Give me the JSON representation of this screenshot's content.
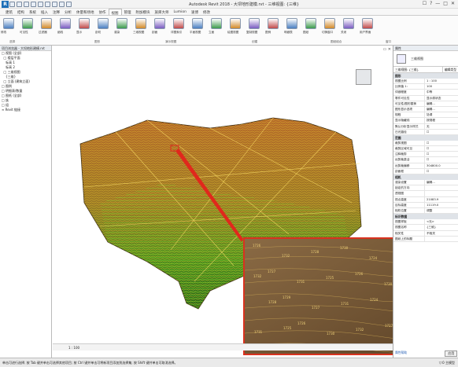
{
  "window": {
    "title": "Autodesk Revit 2018 - 大坝地形建模.rvt - 三维视图: {三维}",
    "right_controls": [
      "☐",
      "?",
      "—",
      "□",
      "✕"
    ]
  },
  "tabs": [
    {
      "label": "建筑"
    },
    {
      "label": "结构"
    },
    {
      "label": "系统"
    },
    {
      "label": "插入"
    },
    {
      "label": "注释"
    },
    {
      "label": "分析"
    },
    {
      "label": "体量和场地"
    },
    {
      "label": "协作"
    },
    {
      "label": "视图",
      "active": true
    },
    {
      "label": "管理"
    },
    {
      "label": "附加模块"
    },
    {
      "label": "族库大师"
    },
    {
      "label": "Lumion"
    },
    {
      "label": "速博"
    },
    {
      "label": "修改"
    }
  ],
  "ribbon": {
    "buttons": [
      {
        "label": "修改",
        "icon": "arrow-icon"
      },
      {
        "label": "可见性",
        "icon": "eye-icon"
      },
      {
        "label": "过滤器",
        "icon": "filter-icon"
      },
      {
        "label": "细线",
        "icon": "line-icon"
      },
      {
        "label": "显示",
        "icon": "show-icon"
      },
      {
        "label": "剖切",
        "icon": "section-icon"
      },
      {
        "label": "渲染",
        "icon": "render-icon"
      },
      {
        "label": "三维视图",
        "icon": "cube-icon"
      },
      {
        "label": "剖面",
        "icon": "cut-icon"
      },
      {
        "label": "详图索引",
        "icon": "callout-icon"
      },
      {
        "label": "平面视图",
        "icon": "plan-icon"
      },
      {
        "label": "立面",
        "icon": "elevation-icon"
      },
      {
        "label": "绘图视图",
        "icon": "draw-icon"
      },
      {
        "label": "复制视图",
        "icon": "duplicate-icon"
      },
      {
        "label": "图例",
        "icon": "legend-icon"
      },
      {
        "label": "明细表",
        "icon": "schedule-icon"
      },
      {
        "label": "图纸",
        "icon": "sheet-icon"
      },
      {
        "label": "切换窗口",
        "icon": "window-icon"
      },
      {
        "label": "关闭",
        "icon": "close-window-icon"
      },
      {
        "label": "用户界面",
        "icon": "ui-icon"
      }
    ],
    "groups": [
      "选择",
      "图形",
      "演示视图",
      "创建",
      "图纸组合",
      "窗口"
    ]
  },
  "project_browser": {
    "header": "项目浏览器 - 大坝地形建模.rvt",
    "items": [
      "□ 视图 (全部)",
      "  □ 楼层平面",
      "    标高 1",
      "    标高 2",
      "  □ 三维视图",
      "    {三维}",
      "  □ 立面 (建筑立面)",
      "□ 图例",
      "□ 明细表/数量",
      "□ 图纸 (全部)",
      "□ 族",
      "□ 组",
      "∞ Revit 链接"
    ]
  },
  "properties": {
    "header": "属性",
    "type": "三维视图",
    "type_selector": "三维视图: {三维}",
    "edit_type": "编辑类型",
    "sections": [
      {
        "name": "图形",
        "rows": [
          [
            "视图比例",
            "1 : 100"
          ],
          [
            "比例值 1:",
            "100"
          ],
          [
            "详细程度",
            "中等"
          ],
          [
            "零件可见性",
            "显示原状态"
          ],
          [
            "可见性/图形替换",
            "编辑..."
          ],
          [
            "图形显示选项",
            "编辑..."
          ],
          [
            "规程",
            "协调"
          ],
          [
            "显示隐藏线",
            "按规程"
          ],
          [
            "默认分析显示样式",
            "无"
          ],
          [
            "日光路径",
            "☐"
          ]
        ]
      },
      {
        "name": "范围",
        "rows": [
          [
            "裁剪视图",
            "☐"
          ],
          [
            "裁剪区域可见",
            "☐"
          ],
          [
            "注释裁剪",
            "☐"
          ],
          [
            "远剪裁激活",
            "☐"
          ],
          [
            "远剪裁偏移",
            "304800.0"
          ],
          [
            "剖面框",
            "☐"
          ]
        ]
      },
      {
        "name": "相机",
        "rows": [
          [
            "渲染设置",
            "编辑..."
          ],
          [
            "锁定的方向",
            ""
          ],
          [
            "透视图",
            ""
          ],
          [
            "视点高度",
            "21083.9"
          ],
          [
            "目标高度",
            "11119.0"
          ],
          [
            "相机位置",
            "调整"
          ]
        ]
      },
      {
        "name": "标识数据",
        "rows": [
          [
            "视图样板",
            "<无>"
          ],
          [
            "视图名称",
            "{三维}"
          ],
          [
            "相关性",
            "不相关"
          ],
          [
            "图纸上的标题",
            ""
          ]
        ]
      }
    ],
    "footer": "属性帮助",
    "apply": "应用"
  },
  "viewport": {
    "tab": "▭ ✕",
    "viewcube": "",
    "inset_labels": [
      "1726",
      "1732",
      "1728",
      "1730",
      "1724",
      "1733",
      "1729",
      "1727",
      "1731",
      "1725",
      "1726",
      "1730",
      "1728",
      "1732",
      "1729",
      "1727",
      "1731",
      "1724",
      "1733",
      "1725",
      "1728",
      "1726",
      "1730",
      "1732",
      "1727",
      "1729",
      "1731",
      "1725"
    ]
  },
  "view_control_bar": "1 : 100",
  "status_bar": "单击可进行选择; 按 Tab 键并单击可选择其他项目; 按 Ctrl 键并单击可将新项目添加到选择集; 按 Shift 键并单击可取消选择。",
  "status_right": "▽:0  主模型"
}
